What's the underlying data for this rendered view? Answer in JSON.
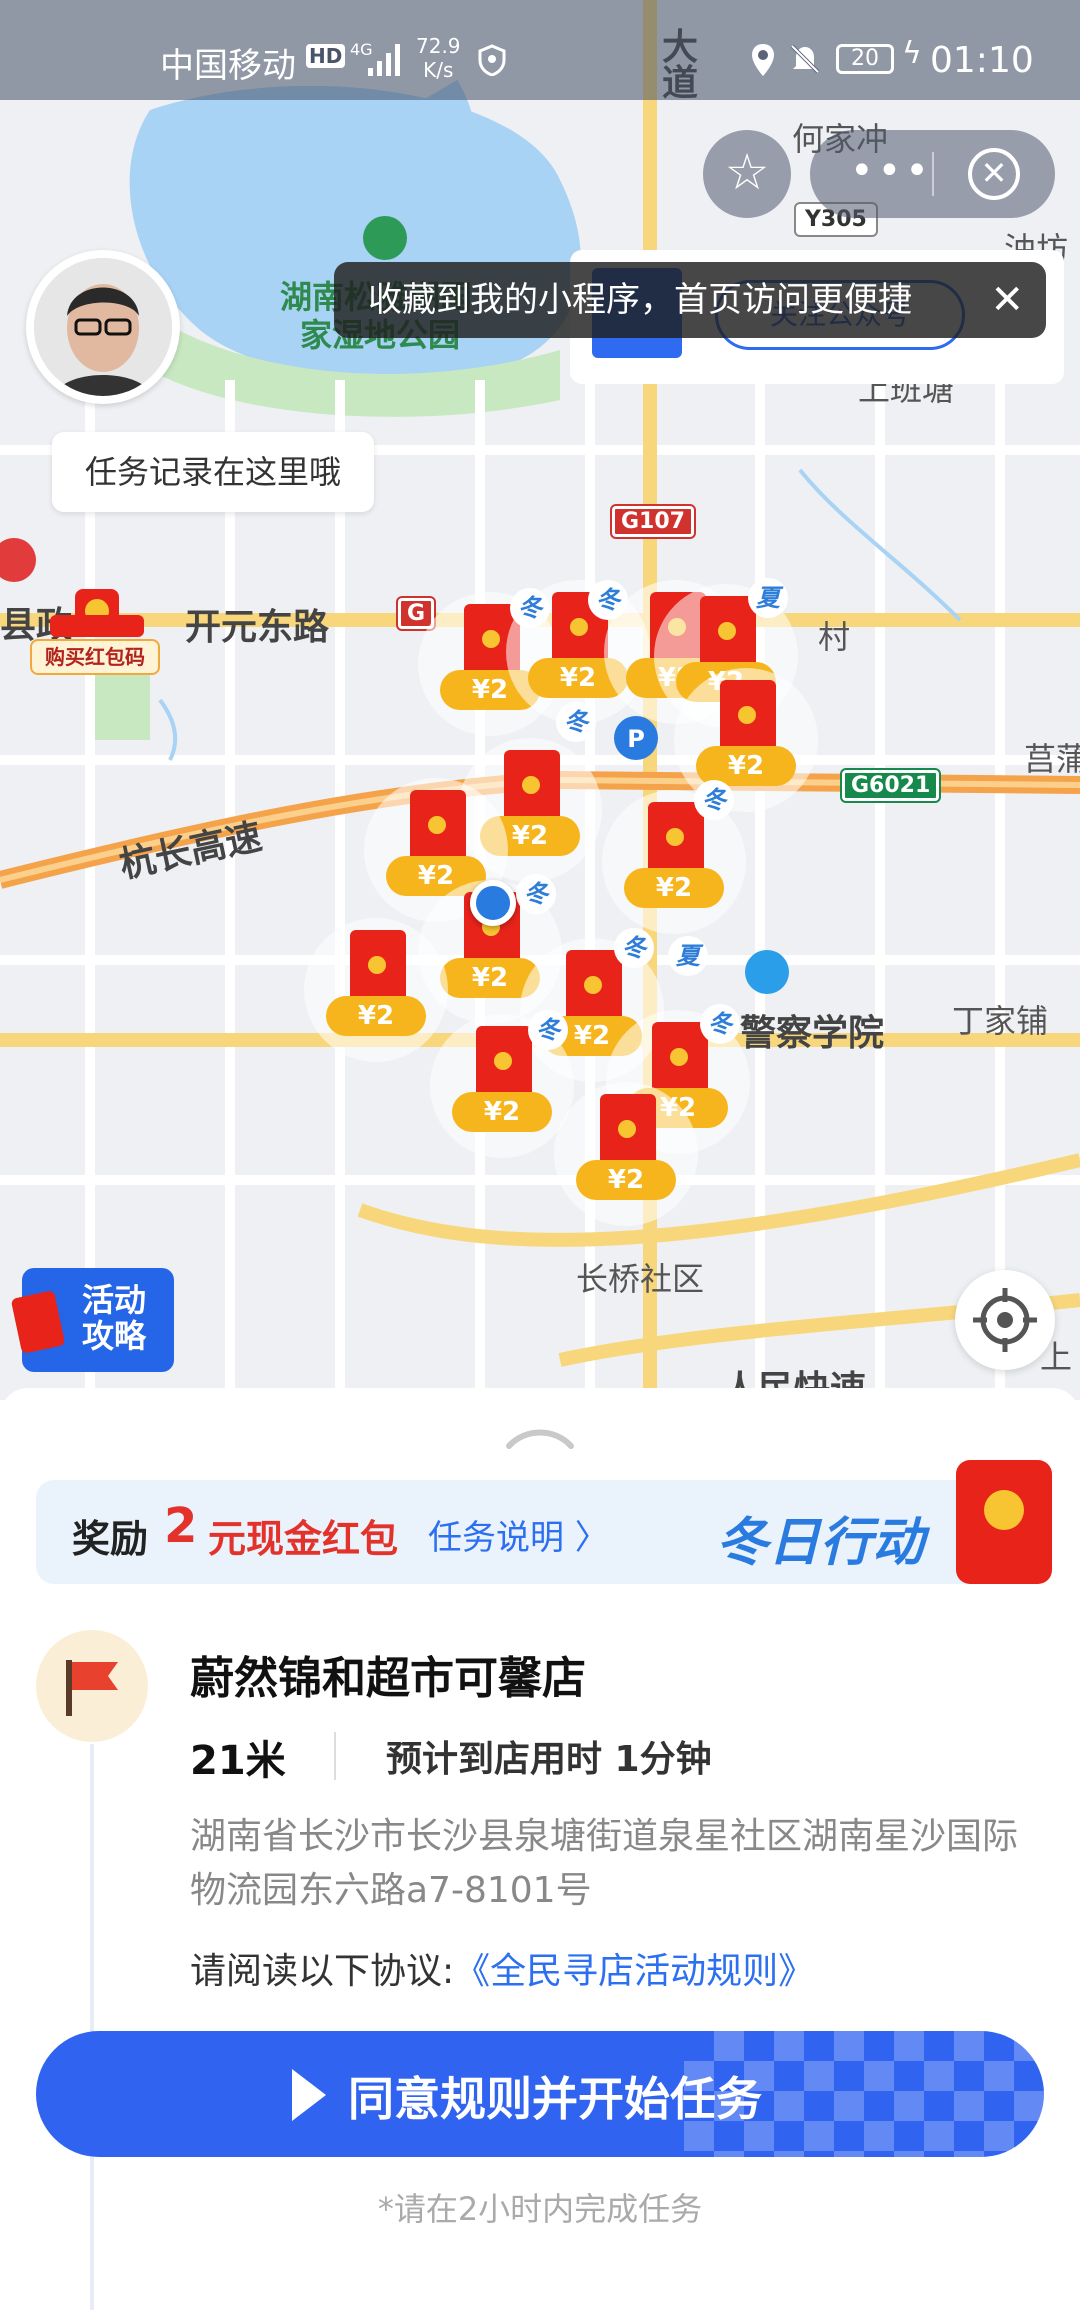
{
  "status_bar": {
    "carrier": "中国移动",
    "hd": "HD",
    "network": "4G",
    "speed_value": "72.9",
    "speed_unit": "K/s",
    "battery": "20",
    "time": "01:10"
  },
  "mini_program": {
    "favorite_tooltip": "收藏到我的小程序，首页访问更便捷",
    "follow_button": "关注公众号",
    "more_icon": "more-icon",
    "close_icon": "close-circle-icon"
  },
  "map": {
    "task_record_tip": "任务记录在这里哦",
    "buy_code_label": "购买红包码",
    "labels": {
      "kaiyuan_road": "开元东路",
      "hangchang_expressway": "杭长高速",
      "police_academy": "警察学院",
      "changqiao_community": "长桥社区",
      "dingjiapu": "丁家铺",
      "hejiachong": "何家冲",
      "wetland_park_1": "湖南松雅湖国",
      "wetland_park_2": "家湿地公园",
      "county_gov": "县政",
      "renmin_expressway": "人民快速",
      "avenue": "大道",
      "village": "村",
      "shang_ban": "上班塘",
      "you_fang": "油坊",
      "pu": "莒蒲",
      "shang": "上"
    },
    "shields": {
      "g107": "G107",
      "g6021": "G6021",
      "y305": "Y305",
      "g_left": "G"
    },
    "activity_button": [
      "活动",
      "攻略"
    ],
    "red_packet_amount": "¥2",
    "season_winter": "冬",
    "season_summer": "夏"
  },
  "sheet": {
    "reward_prefix": "奖励",
    "reward_amount": "2",
    "reward_suffix": "元现金红包",
    "task_explain": "任务说明 〉",
    "campaign_brand": "冬日行动",
    "store_name": "蔚然锦和超市可馨店",
    "distance": "21米",
    "eta": "预计到店用时 1分钟",
    "address": "湖南省长沙市长沙县泉塘街道泉星社区湖南星沙国际物流园东六路a7-8101号",
    "agreement_prefix": "请阅读以下协议:",
    "agreement_link": "《全民寻店活动规则》",
    "start_button": "同意规则并开始任务",
    "footnote": "*请在2小时内完成任务"
  },
  "colors": {
    "primary_blue": "#2f63f0",
    "reward_red": "#e3322b",
    "packet_red": "#e8231a",
    "coin_gold": "#f7b51d"
  }
}
